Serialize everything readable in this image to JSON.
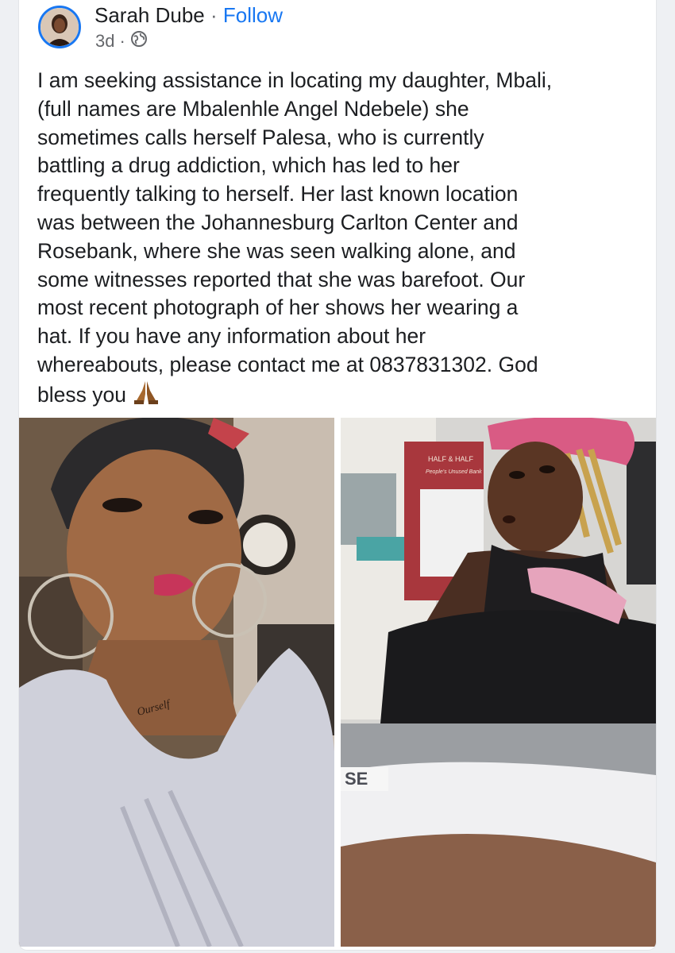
{
  "post": {
    "author": "Sarah Dube",
    "separator": "·",
    "follow_label": "Follow",
    "time": "3d",
    "meta_separator": "·",
    "privacy_icon": "globe-icon",
    "body": "I am seeking assistance in locating my daughter, Mbali,\n(full names are Mbalenhle Angel Ndebele) she\nsometimes calls herself Palesa, who is currently\nbattling a drug addiction, which has led to her\nfrequently talking to herself. Her last known location\nwas between the Johannesburg Carlton Center and\nRosebank, where she was seen walking alone, and\nsome witnesses reported that she was barefoot. Our\nmost recent photograph of her shows her wearing a\nhat. If you have any information about her\nwhereabouts, please contact me at 0837831302. God\nbless you",
    "emoji": "praying-hands-icon"
  },
  "photos": {
    "left_tattoo_text": "Ourself",
    "right_shirt_text_1": "HALF & HALF",
    "right_shirt_text_2": "People's Unused Bank",
    "right_device_text": "SE"
  },
  "colors": {
    "link": "#1877f2",
    "secondary": "#65676b",
    "text": "#1c1e21"
  }
}
